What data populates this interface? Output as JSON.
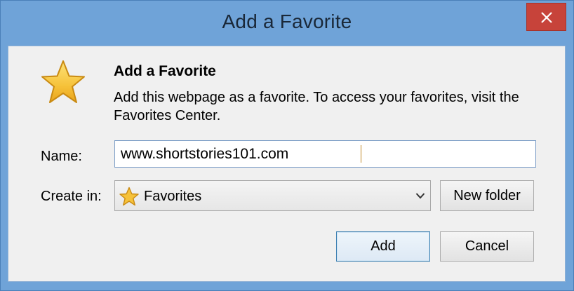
{
  "window": {
    "title": "Add a Favorite",
    "close_glyph": "✕"
  },
  "dialog": {
    "heading": "Add a Favorite",
    "description": "Add this webpage as a favorite. To access your favorites, visit the Favorites Center.",
    "name_label": "Name:",
    "name_value": "www.shortstories101.com",
    "create_in_label": "Create in:",
    "create_in_selected": "Favorites",
    "new_folder_label": "New folder",
    "add_label": "Add",
    "cancel_label": "Cancel"
  },
  "icons": {
    "favorite": "star-icon",
    "folder_select": "star-icon",
    "dropdown": "chevron-down-icon",
    "close": "close-icon"
  },
  "colors": {
    "titlebar": "#6fa3d8",
    "close_button": "#c7433a",
    "star_fill": "#f6c23a",
    "client_bg": "#f0f0f0",
    "default_button_border": "#3c7fb1"
  }
}
